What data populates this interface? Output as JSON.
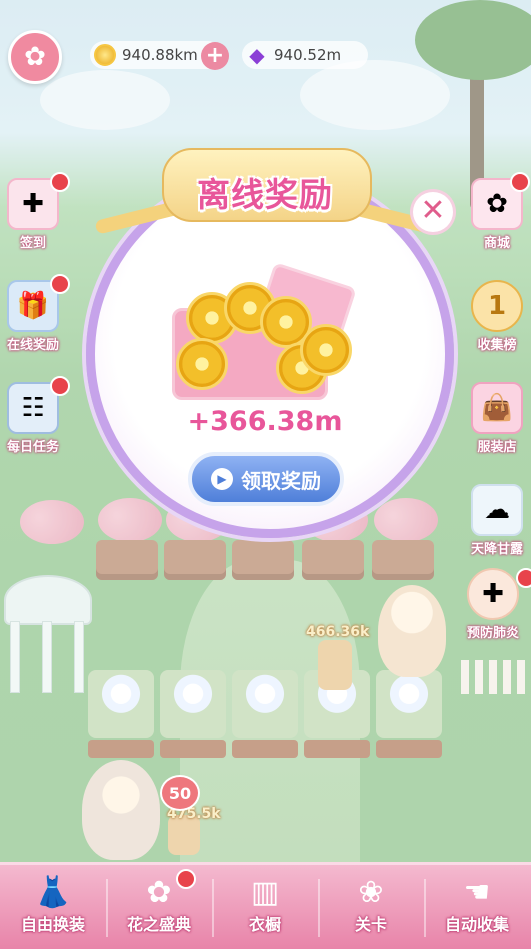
{
  "top_bar": {
    "coins": "940.88km",
    "gems": "940.52m"
  },
  "left_menu": [
    {
      "label": "签到",
      "icon": "calendar-icon",
      "badge": true
    },
    {
      "label": "在线奖励",
      "icon": "gift-box-icon",
      "badge": true
    },
    {
      "label": "每日任务",
      "icon": "task-board-icon",
      "badge": true
    }
  ],
  "right_menu": [
    {
      "label": "商城",
      "icon": "shop-icon",
      "badge": true
    },
    {
      "label": "收集榜",
      "icon": "medal-icon",
      "badge": false
    },
    {
      "label": "服装店",
      "icon": "shopping-bag-icon",
      "badge": false
    },
    {
      "label": "天降甘露",
      "icon": "rainbow-cloud-icon",
      "badge": false
    },
    {
      "label": "预防肺炎",
      "icon": "nurse-icon",
      "badge": true
    }
  ],
  "modal": {
    "title": "离线奖励",
    "reward_amount": "+366.38m",
    "claim_label": "领取奖励"
  },
  "scene": {
    "float_value_1": "466.36k",
    "float_value_2": "475.5k",
    "heart_level": "50"
  },
  "bottom_nav": [
    {
      "label": "自由换装",
      "icon": "dress-icon"
    },
    {
      "label": "花之盛典",
      "icon": "flower-icon",
      "badge": true
    },
    {
      "label": "衣橱",
      "icon": "wardrobe-icon"
    },
    {
      "label": "关卡",
      "icon": "level-icon"
    },
    {
      "label": "自动收集",
      "icon": "hand-icon"
    }
  ],
  "colors": {
    "accent_pink": "#e8569a",
    "claim_blue": "#4f7fd9",
    "modal_border": "#c6a3ea",
    "badge_red": "#e8434b"
  }
}
